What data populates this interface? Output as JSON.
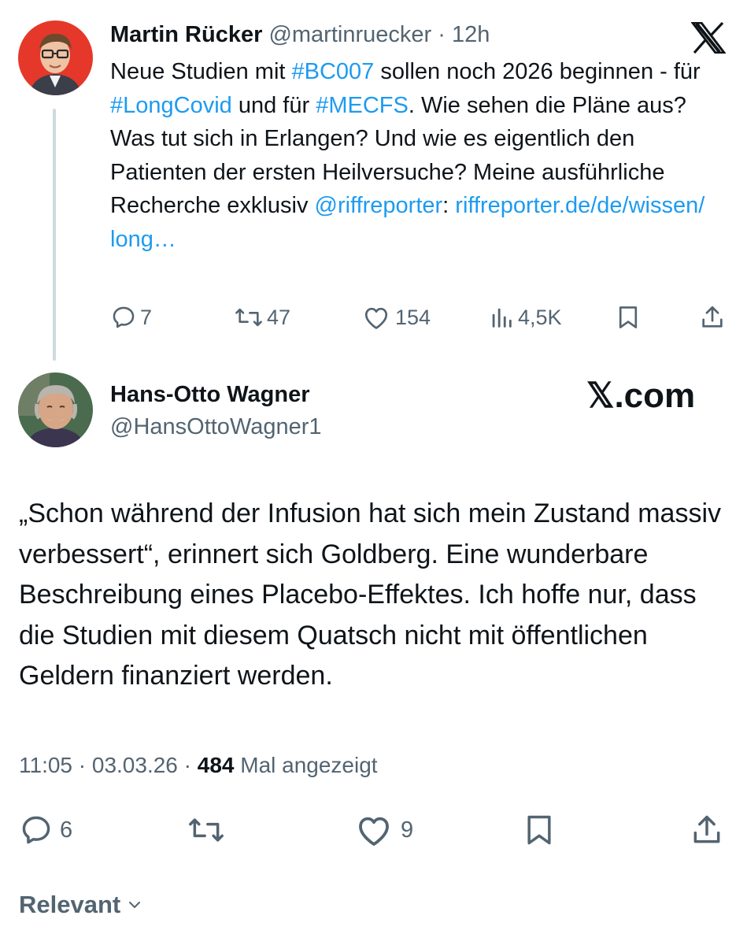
{
  "tweet1": {
    "name": "Martin Rücker",
    "handle": "@martinruecker",
    "time": "· 12h",
    "text": {
      "p1": "Neue Studien mit ",
      "tag1": "#BC007",
      "p2": " sollen noch 2026 beginnen - für ",
      "tag2": "#LongCovid",
      "p3": " und für ",
      "tag3": "#MECFS",
      "p4": ". Wie sehen die Pläne aus? Was tut sich in Erlangen? Und wie es eigentlich den Patienten der ersten Heilversuche? Meine ausführliche Recherche exklusiv ",
      "mention": "@riffreporter",
      "p5": ": ",
      "url": "riffreporter.de/de/wissen/ long…"
    },
    "actions": {
      "replies": "7",
      "reposts": "47",
      "likes": "154",
      "views": "4,5K"
    },
    "icons": [
      "reply-icon",
      "repost-icon",
      "like-icon",
      "views-icon",
      "bookmark-icon",
      "share-icon",
      "x-logo-icon"
    ]
  },
  "tweet2": {
    "name": "Hans-Otto Wagner",
    "handle": "@HansOttoWagner1",
    "brand": "𝕏.com",
    "text": "„Schon während der Infusion hat sich mein Zustand massiv verbessert“, erinnert sich Goldberg. Eine wunderbare Beschreibung eines Placebo-Effektes. Ich hoffe nur, dass die Studien mit diesem Quatsch nicht mit öffentlichen Geldern finanziert werden.",
    "time": "11:05 · 03.03.26 · ",
    "views_count": "484",
    "views_label": " Mal angezeigt",
    "actions": {
      "replies": "6",
      "likes": "9"
    }
  },
  "sort": {
    "label": "Relevant"
  },
  "colors": {
    "link": "#1d9bf0",
    "secondary_text": "#536471",
    "primary_text": "#0f1419",
    "thread_line": "#cfd9de"
  }
}
